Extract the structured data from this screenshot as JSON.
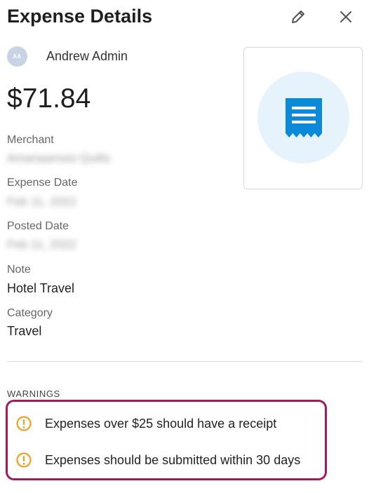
{
  "header": {
    "title": "Expense Details",
    "edit_icon": "pencil-icon",
    "close_icon": "close-icon"
  },
  "user": {
    "initials": "AA",
    "name": "Andrew Admin"
  },
  "amount": "$71.84",
  "fields": {
    "merchant": {
      "label": "Merchant",
      "value": "Amanaamsio Quilts"
    },
    "expense_date": {
      "label": "Expense Date",
      "value": "Feb 11, 2022"
    },
    "posted_date": {
      "label": "Posted Date",
      "value": "Feb 11, 2022"
    },
    "note": {
      "label": "Note",
      "value": "Hotel Travel"
    },
    "category": {
      "label": "Category",
      "value": "Travel"
    }
  },
  "receipt": {
    "icon": "receipt-icon"
  },
  "warnings": {
    "label": "WARNINGS",
    "items": [
      "Expenses over $25 should have a receipt",
      "Expenses should be submitted within 30 days"
    ]
  },
  "colors": {
    "warning_border": "#a01c5e",
    "warning_icon": "#f0a020",
    "receipt_blue": "#0a8ad8",
    "receipt_circle": "#e6f3fc"
  }
}
